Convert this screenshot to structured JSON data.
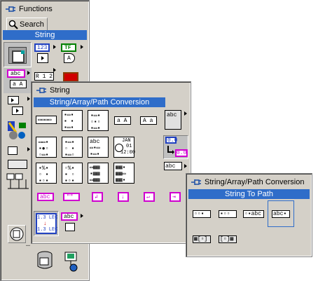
{
  "functions_palette": {
    "title": "Functions",
    "search_label": "Search",
    "category_label": "String",
    "category_icons": [
      "numeric-123-icon",
      "boolean-tf-icon",
      "string-abc-icon",
      "array-icon",
      "cluster-icon"
    ],
    "icon_texts": {
      "num": "123",
      "tf": "TF",
      "abc": "abc",
      "aA": "a A",
      "r12": "R 1 2"
    }
  },
  "string_palette": {
    "title": "String",
    "section_label": "String/Array/Path Conversion",
    "row1_texts": [
      "a A",
      "A a"
    ],
    "side_texts": [
      "abc",
      "0.0",
      "abc"
    ],
    "date_icon_text": [
      "JAN",
      "01",
      "12:00"
    ],
    "conversion_text": [
      "1.3 LEC",
      "1.3 LEC"
    ],
    "conversion_abc": "abc"
  },
  "conversion_palette": {
    "title": "String/Array/Path Conversion",
    "section_label": "String To Path",
    "items": [
      "string-to-path",
      "path-to-string",
      "build-path",
      "string-to-byte-array",
      "refnum-to-path",
      "path-to-refnum"
    ]
  },
  "colors": {
    "palette_bg": "#d4d0c8",
    "title_blue": "#2f6dc9",
    "magenta": "#d000d0",
    "selection_border": "#2f6dc9"
  }
}
